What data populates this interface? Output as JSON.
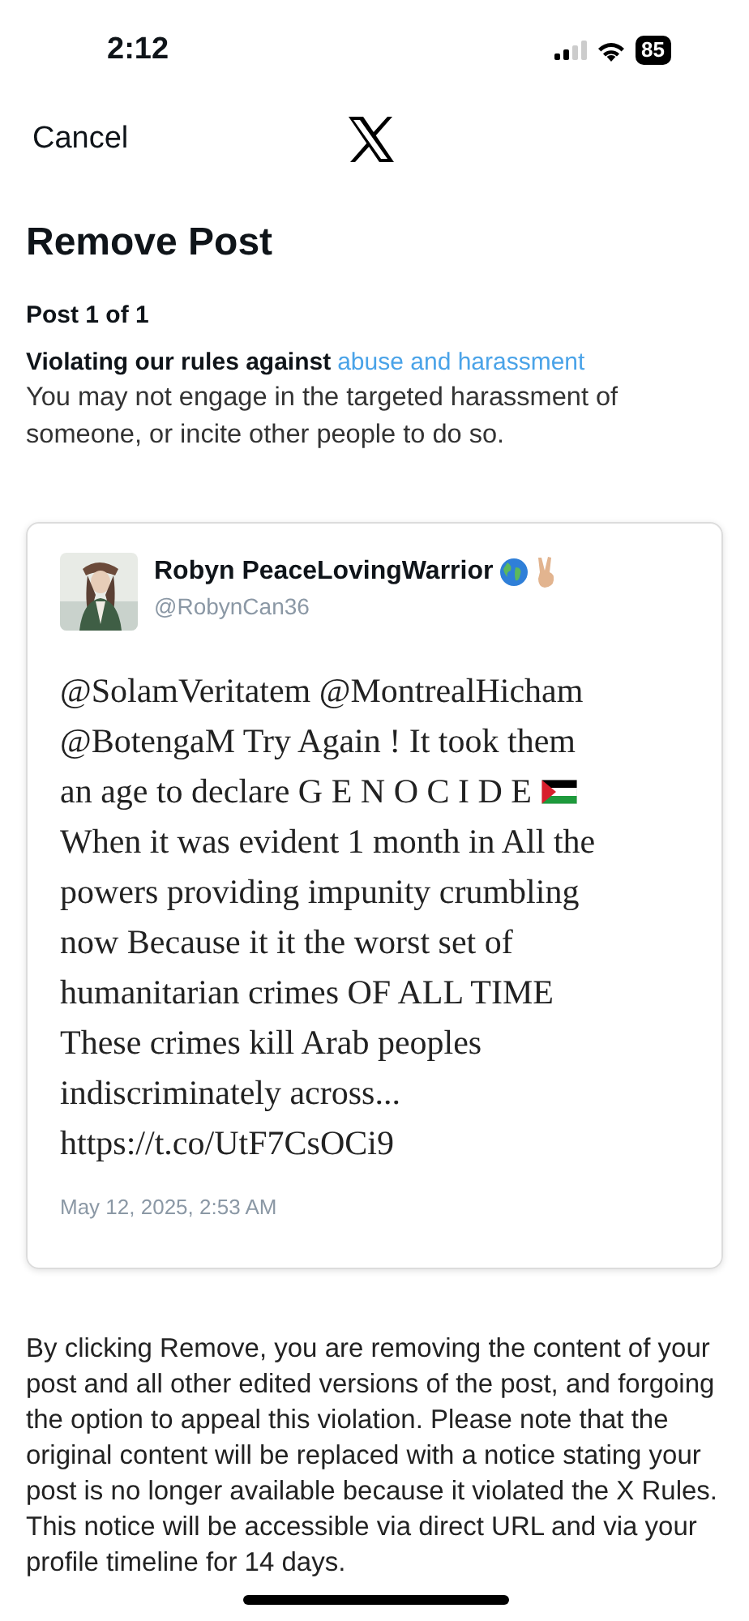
{
  "status_bar": {
    "time": "2:12",
    "battery": "85"
  },
  "nav": {
    "cancel": "Cancel"
  },
  "title": "Remove Post",
  "post_count": "Post 1 of 1",
  "violation": {
    "prefix": "Violating our rules against",
    "link": "abuse and harassment",
    "description": "You may not engage in the targeted harassment of someone, or incite other people to do so."
  },
  "post": {
    "display_name": "Robyn PeaceLovingWarrior",
    "handle": "@RobynCan36",
    "lines": [
      {
        "text": "@SolamVeritatem @MontrealHicham",
        "flag": false
      },
      {
        "text": "@BotengaM Try Again ! It took them",
        "flag": false
      },
      {
        "text": "an age to declare G E N O C I D E",
        "flag": true
      },
      {
        "text": "When it was evident 1 month in All the",
        "flag": false
      },
      {
        "text": "powers providing impunity crumbling",
        "flag": false
      },
      {
        "text": "now Because it it the worst set of",
        "flag": false
      },
      {
        "text": "humanitarian crimes OF ALL TIME",
        "flag": false
      },
      {
        "text": "These crimes kill Arab peoples",
        "flag": false
      },
      {
        "text": "indiscriminately across...",
        "flag": false
      },
      {
        "text": "https://t.co/UtF7CsOCi9",
        "flag": false
      }
    ],
    "timestamp": "May 12, 2025, 2:53 AM"
  },
  "disclaimer": "By clicking Remove, you are removing the content of your post and all other edited versions of the post, and forgoing the option to appeal this violation. Please note that the original content will be replaced with a notice stating your post is no longer available because it violated the X Rules. This notice will be accessible via direct URL and via your profile timeline for 14 days."
}
